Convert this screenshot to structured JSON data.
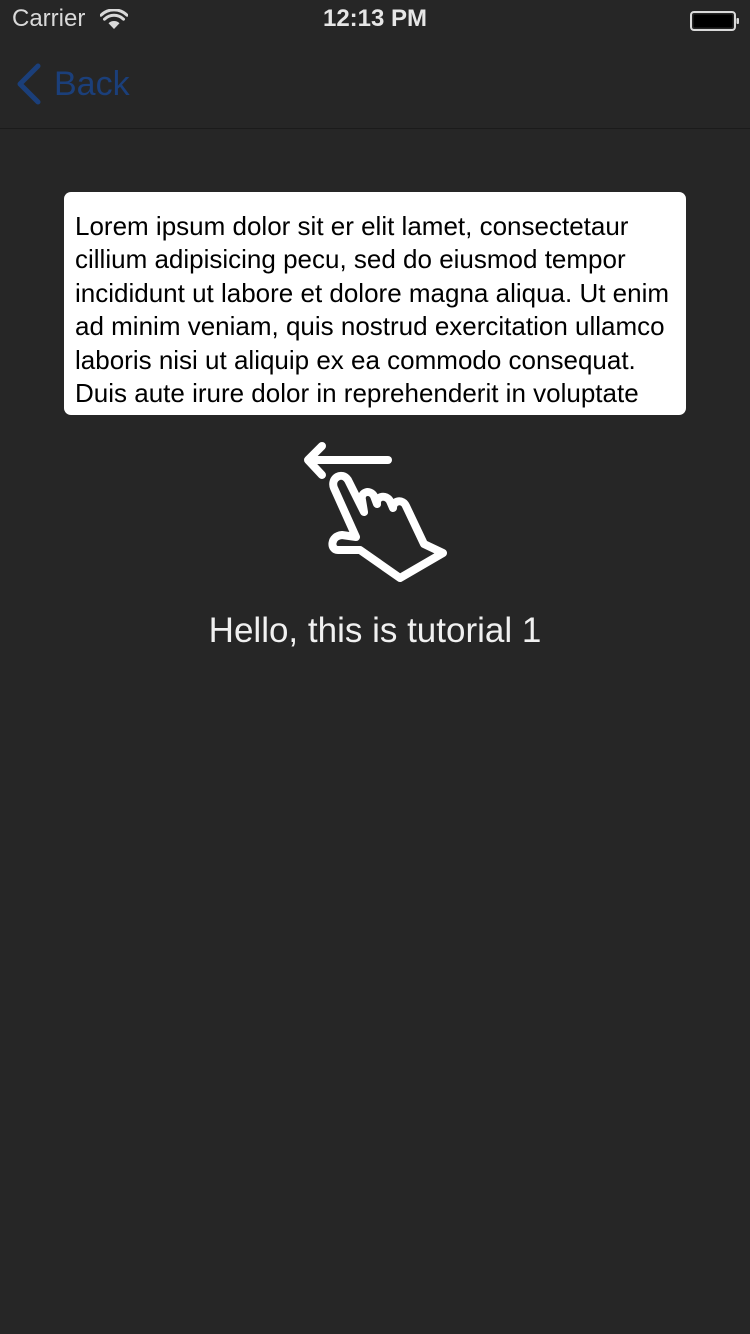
{
  "status_bar": {
    "carrier": "Carrier",
    "time": "12:13 PM",
    "icons": [
      "wifi-icon",
      "battery-icon"
    ]
  },
  "nav": {
    "back_label": "Back",
    "back_color": "#1b3f7a"
  },
  "card": {
    "text": "Lorem ipsum dolor sit er elit lamet, consectetaur cillium adipisicing pecu, sed do eiusmod tempor incididunt ut labore et dolore magna aliqua. Ut enim ad minim veniam, quis nostrud exercitation ullamco laboris nisi ut aliquip ex ea commodo consequat. Duis aute irure dolor in reprehenderit in voluptate velit esse cillum dolore eu fugiat nulla pariatur."
  },
  "gesture": {
    "icon": "swipe-left-gesture-icon"
  },
  "tutorial": {
    "title": "Hello, this is tutorial 1"
  },
  "colors": {
    "background": "#262626",
    "card_background": "#ffffff"
  }
}
